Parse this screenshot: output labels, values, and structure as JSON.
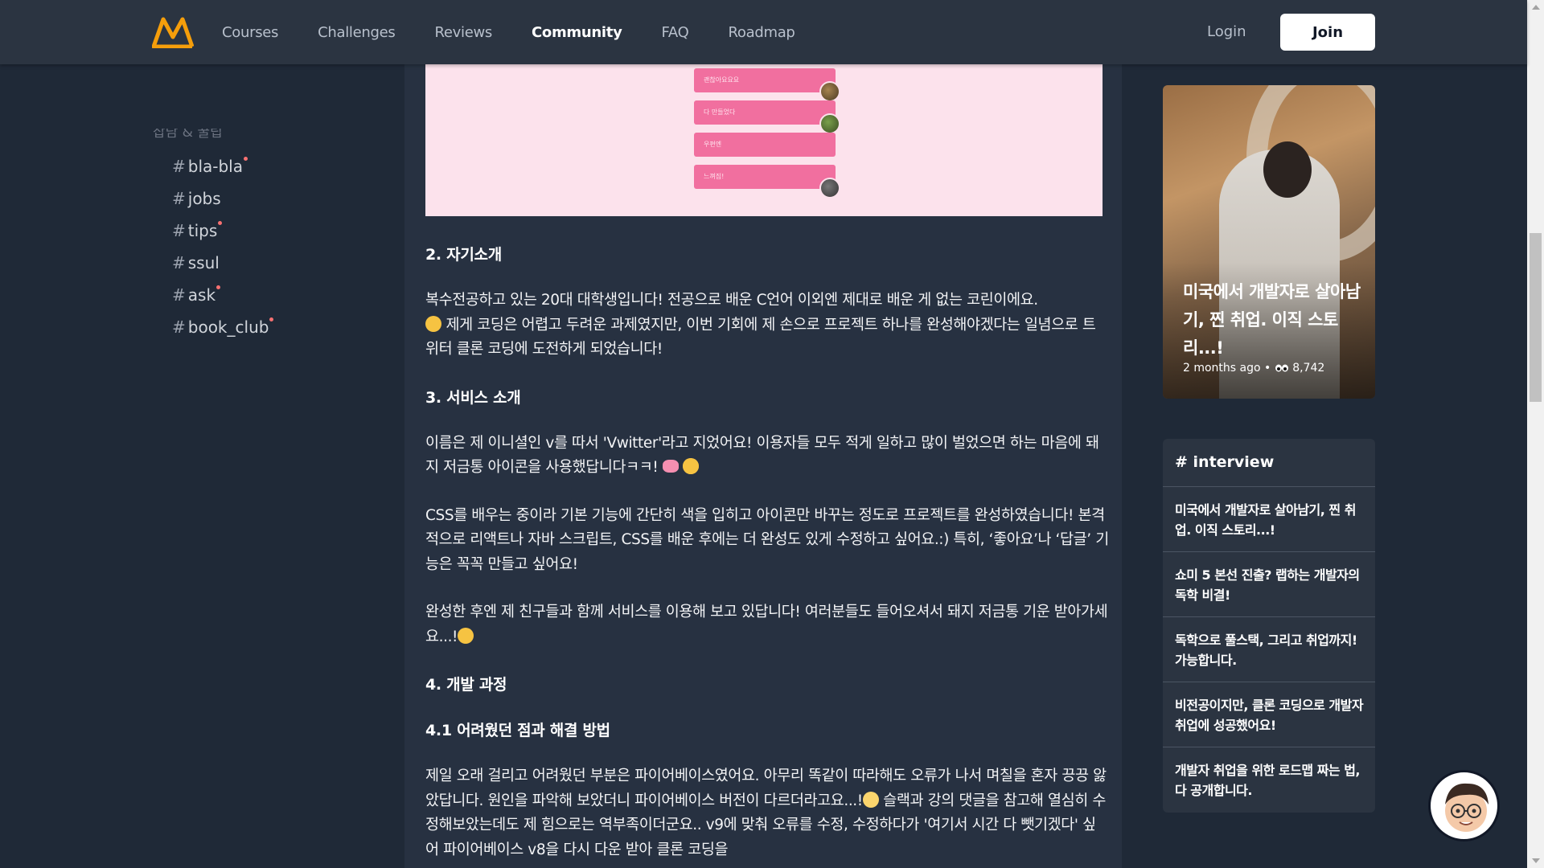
{
  "header": {
    "nav": [
      "Courses",
      "Challenges",
      "Reviews",
      "Community",
      "FAQ",
      "Roadmap"
    ],
    "active_nav": "Community",
    "login_label": "Login",
    "join_label": "Join",
    "colors": {
      "logo": "#f59e0b",
      "background": "#2b3441",
      "active": "#ffffff"
    }
  },
  "sidebar": {
    "section_label": "잡담 & 꿀팁",
    "channels": [
      {
        "name": "bla-bla",
        "unread": true
      },
      {
        "name": "jobs",
        "unread": false
      },
      {
        "name": "tips",
        "unread": true
      },
      {
        "name": "ssul",
        "unread": false
      },
      {
        "name": "ask",
        "unread": true
      },
      {
        "name": "book_club",
        "unread": true
      }
    ]
  },
  "post": {
    "image_bubbles": [
      "괜찮아요요요",
      "다 만들었다",
      "우편엔",
      "느껴짐!"
    ],
    "sections": [
      {
        "heading": "2. 자기소개"
      },
      {
        "paragraph": [
          "복수전공하고 있는 20대 대학생입니다! 전공으로 배운 C언어 이외엔 제대로 배운 게 없는 코린이에요.",
          " 제게 코딩은 어렵고 두려운 과제였지만, 이번 기회에 제 손으로 프로젝트 하나를 완성해야겠다는 일념으로 트위터 클론 코딩에 도전하게 되었습니다!"
        ]
      },
      {
        "heading": "3. 서비스 소개"
      },
      {
        "paragraph": [
          "이름은 제 이니셜인 v를 따서 'Vwitter'라고 지었어요! 이용자들 모두 적게 일하고 많이 벌었으면 하는 마음에 돼지 저금통 아이콘을 사용했답니다ㅋㅋ! "
        ]
      },
      {
        "paragraph": [
          "CSS를 배우는 중이라 기본 기능에 간단히 색을 입히고 아이콘만 바꾸는 정도로 프로젝트를 완성하였습니다! 본격적으로 리액트나 자바 스크립트, CSS를 배운 후에는 더 완성도 있게 수정하고 싶어요.:) 특히, ‘좋아요’나 ‘답글’ 기능은 꼭꼭 만들고 싶어요!"
        ]
      },
      {
        "paragraph": [
          "완성한 후엔 제 친구들과 함께 서비스를 이용해 보고 있답니다! 여러분들도 들어오셔서 돼지 저금통 기운 받아가세요...!"
        ]
      },
      {
        "heading": "4. 개발 과정"
      },
      {
        "heading": "4.1 어려웠던 점과 해결 방법"
      },
      {
        "paragraph": [
          "제일 오래 걸리고 어려웠던 부분은 파이어베이스였어요. 아무리 똑같이 따라해도 오류가 나서 며칠을 혼자 끙끙 앓았답니다. 원인을 파악해 보았더니 파이어베이스 버전이 다르더라고요...!",
          " 슬랙과 강의 댓글을 참고해 열심히 수정해보았는데도 제 힘으로는 역부족이더군요.. v9에 맞춰 오류를 수정, 수정하다가 '여기서 시간 다 뺏기겠다' 싶어 파이어베이스 v8을 다시 다운 받아 클론 코딩을"
        ]
      }
    ]
  },
  "feature": {
    "title": "미국에서 개발자로 살아남기, 찐 취업. 이직 스토리...!",
    "time": "2 months ago",
    "views": "8,742"
  },
  "interview": {
    "title": "# interview",
    "items": [
      "미국에서 개발자로 살아남기, 찐 취업. 이직 스토리...!",
      "쇼미 5 본선 진출? 랩하는 개발자의 독학 비결!",
      "독학으로 풀스택, 그리고 취업까지! 가능합니다.",
      "비전공이지만, 클론 코딩으로 개발자 취업에 성공했어요!",
      "개발자 취업을 위한 로드맵 짜는 법, 다 공개합니다."
    ]
  }
}
